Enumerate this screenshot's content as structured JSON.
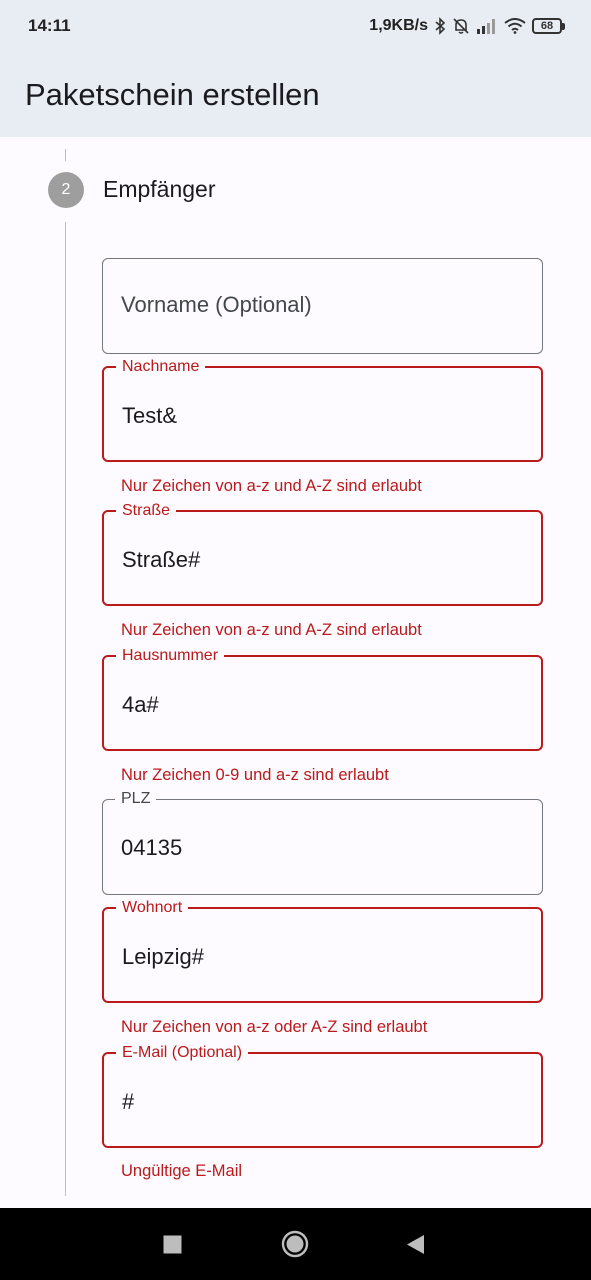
{
  "status_bar": {
    "time": "14:11",
    "network_speed": "1,9KB/s",
    "battery_level": "68",
    "icons": [
      "bluetooth-icon",
      "bell-off-icon",
      "signal-icon",
      "wifi-icon",
      "battery-icon"
    ]
  },
  "app_bar": {
    "title": "Paketschein erstellen"
  },
  "stepper": {
    "step_number": "2",
    "step_title": "Empfänger"
  },
  "form": {
    "vorname": {
      "placeholder": "Vorname (Optional)",
      "value": ""
    },
    "nachname": {
      "label": "Nachname",
      "value": "Test&",
      "error": "Nur Zeichen von a-z und A-Z sind erlaubt"
    },
    "strasse": {
      "label": "Straße",
      "value": "Straße#",
      "error": "Nur Zeichen von a-z und A-Z sind erlaubt"
    },
    "hausnummer": {
      "label": "Hausnummer",
      "value": "4a#",
      "error": "Nur Zeichen 0-9 und a-z sind erlaubt"
    },
    "plz": {
      "label": "PLZ",
      "value": "04135"
    },
    "wohnort": {
      "label": "Wohnort",
      "value": "Leipzig#",
      "error": "Nur Zeichen von a-z oder A-Z sind erlaubt"
    },
    "email": {
      "label": "E-Mail (Optional)",
      "value": "#",
      "error": "Ungültige E-Mail"
    }
  },
  "colors": {
    "error": "#ba1a1a",
    "outline": "#74777f",
    "app_bar_bg": "#e8edf4",
    "page_bg": "#fdfbff"
  },
  "nav_bar": {
    "icons": [
      "recents-square-icon",
      "home-circle-icon",
      "back-triangle-icon"
    ]
  }
}
